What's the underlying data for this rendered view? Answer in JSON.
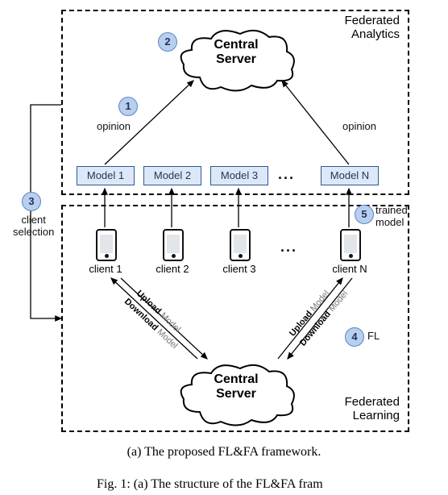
{
  "boxes": {
    "fa_label_l1": "Federated",
    "fa_label_l2": "Analytics",
    "fl_label_l1": "Federated",
    "fl_label_l2": "Learning"
  },
  "clouds": {
    "top_l1": "Central",
    "top_l2": "Server",
    "bottom_l1": "Central",
    "bottom_l2": "Server"
  },
  "models": {
    "m1": "Model 1",
    "m2": "Model 2",
    "m3": "Model 3",
    "mN": "Model N"
  },
  "clients": {
    "c1": "client 1",
    "c2": "client 2",
    "c3": "client 3",
    "cN": "client N"
  },
  "labels": {
    "opinion_left": "opinion",
    "opinion_right": "opinion",
    "client_selection_l1": "client",
    "client_selection_l2": "selection",
    "trained_model_l1": "trained",
    "trained_model_l2": "model",
    "fl": "FL",
    "upload": "Upload",
    "download": "Download",
    "model_word": "Model"
  },
  "steps": {
    "s1": "1",
    "s2": "2",
    "s3": "3",
    "s4": "4",
    "s5": "5"
  },
  "dots": {
    "models": "...",
    "clients": "..."
  },
  "captions": {
    "a": "(a) The proposed FL&FA framework.",
    "fig_partial": "Fig. 1: (a) The structure of the FL&FA fram"
  }
}
